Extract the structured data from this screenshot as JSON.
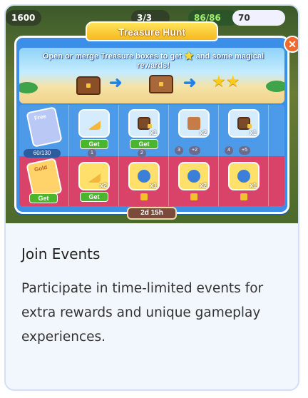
{
  "hud": {
    "level": "1600",
    "counter": "3/3",
    "energy": "86/86",
    "coins": "70"
  },
  "game": {
    "title": "Treasure Hunt",
    "intro": "Open or merge Treasure boxes to get ⭐ and some magical rewards!",
    "close_icon": "✕",
    "pass": {
      "free_label": "Free",
      "free_progress": "60/130",
      "gold_label": "Gold",
      "gold_get": "Get"
    },
    "columns": [
      {
        "top_qty": "",
        "top_action": "Get",
        "top_level": "1",
        "bottom_qty": "x2",
        "bottom_action": "Get"
      },
      {
        "top_qty": "x1",
        "top_action": "Get",
        "top_level": "2",
        "bottom_qty": "x1",
        "bottom_action": ""
      },
      {
        "top_qty": "x2",
        "top_action": "",
        "top_level": "3",
        "top_bonus": "+2",
        "bottom_qty": "x2",
        "bottom_action": ""
      },
      {
        "top_qty": "x1",
        "top_action": "",
        "top_level": "4",
        "top_bonus": "+5",
        "bottom_qty": "x1",
        "bottom_action": ""
      }
    ],
    "timer": "2d 15h"
  },
  "caption": {
    "title": "Join Events",
    "body": "Participate in time-limited events for extra rewards and unique gameplay experiences."
  }
}
